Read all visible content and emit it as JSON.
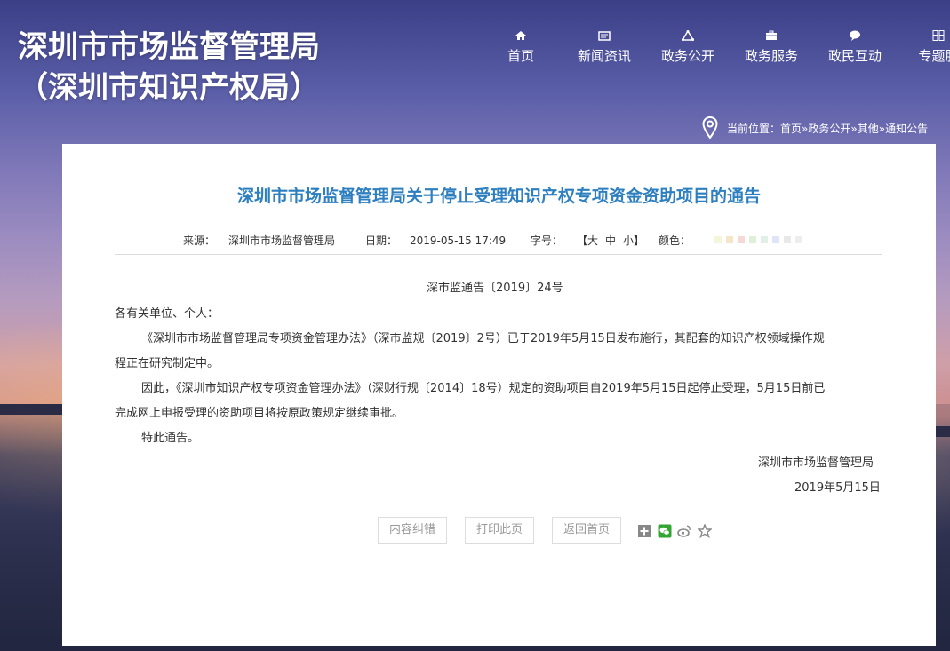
{
  "header": {
    "logo_line1": "深圳市市场监督管理局",
    "logo_line2": "（深圳市知识产权局）"
  },
  "nav": {
    "items": [
      {
        "label": "首页",
        "icon": "home-icon"
      },
      {
        "label": "新闻资讯",
        "icon": "news-icon"
      },
      {
        "label": "政务公开",
        "icon": "triangle-network-icon"
      },
      {
        "label": "政务服务",
        "icon": "briefcase-icon"
      },
      {
        "label": "政民互动",
        "icon": "chat-icon"
      },
      {
        "label": "专题服",
        "icon": "grid-icon"
      }
    ]
  },
  "breadcrumb": {
    "prefix": "当前位置：",
    "items": [
      "首页",
      "政务公开",
      "其他",
      "通知公告"
    ],
    "sep": "»"
  },
  "article": {
    "title": "深圳市市场监督管理局关于停止受理知识产权专项资金资助项目的通告",
    "meta": {
      "source_label": "来源：",
      "source": "深圳市市场监督管理局",
      "date_label": "日期：",
      "date": "2019-05-15 17:49",
      "size_label": "字号：",
      "size_open": "【",
      "size_large": "大",
      "size_medium": "中",
      "size_small": "小",
      "size_close": "】",
      "color_label": "颜色：",
      "colors": [
        "#f5f5dc",
        "#f5e6c8",
        "#f8d7d7",
        "#dff0d8",
        "#e0f0e8",
        "#e0e4f8",
        "#e8e8e8",
        "#eeeeee"
      ]
    },
    "doc_number": "深市监通告〔2019〕24号",
    "salutation": "各有关单位、个人：",
    "para1_line1": "《深圳市市场监督管理局专项资金管理办法》（深市监规〔2019〕2号）已于2019年5月15日发布施行，其配套的知识产权领域操作规",
    "para1_line2": "程正在研究制定中。",
    "para2_line1": "因此，《深圳市知识产权专项资金管理办法》（深财行规〔2014〕18号）规定的资助项目自2019年5月15日起停止受理，5月15日前已",
    "para2_line2": "完成网上申报受理的资助项目将按原政策规定继续审批。",
    "closing": "特此通告。",
    "signature": "深圳市市场监督管理局",
    "sign_date": "2019年5月15日"
  },
  "actions": {
    "correct": "内容纠错",
    "print": "打印此页",
    "back_home": "返回首页"
  },
  "share": [
    "plus-share-icon",
    "wechat-icon",
    "weibo-icon",
    "favorite-star-icon"
  ]
}
